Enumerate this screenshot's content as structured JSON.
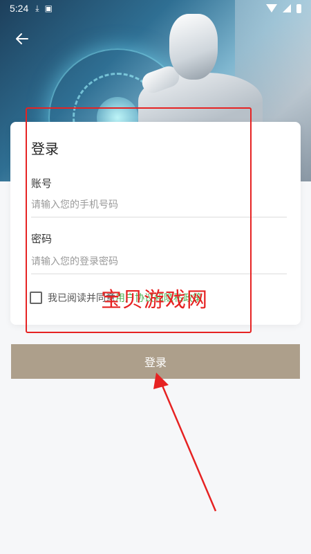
{
  "status_bar": {
    "time": "5:24",
    "icons": [
      "download-icon",
      "a-icon",
      "wifi-icon",
      "signal-icon",
      "battery-icon"
    ]
  },
  "header": {
    "back_icon": "arrow-left-icon",
    "hero_image": "robot-illustration"
  },
  "card": {
    "title": "登录",
    "account_label": "账号",
    "account_placeholder": "请输入您的手机号码",
    "account_value": "",
    "password_label": "密码",
    "password_placeholder": "请输入您的登录密码",
    "password_value": "",
    "agreement_prefix": "我已阅读并同意",
    "agreement_link": "用户协议和隐私政策",
    "agreement_checked": false
  },
  "login_button_label": "登录",
  "annotations": {
    "watermark_text": "宝贝游戏网",
    "color": "#e62222"
  },
  "colors": {
    "button_bg": "#ad9f8b",
    "link": "#4caf50",
    "background": "#f6f7f9"
  }
}
